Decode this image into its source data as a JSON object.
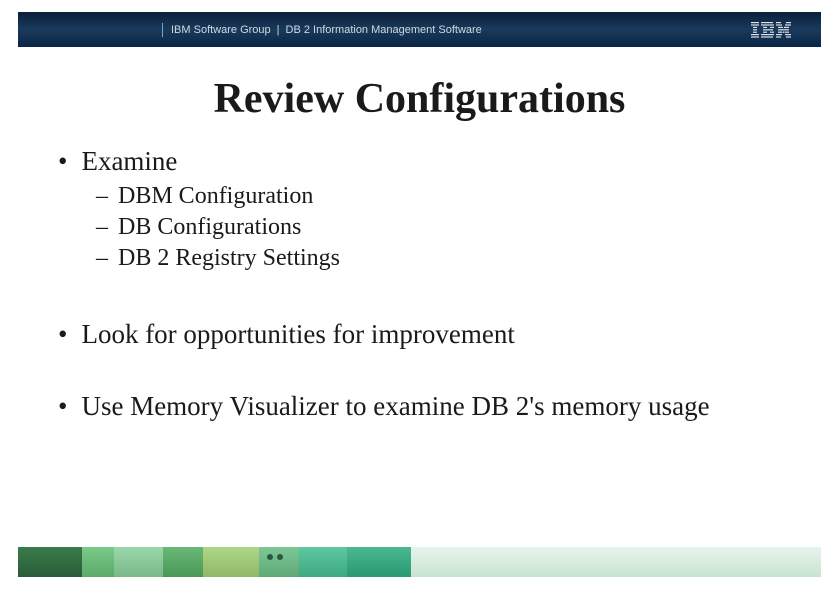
{
  "header": {
    "group_text": "IBM Software Group",
    "separator": "|",
    "product_text": "DB 2 Information Management Software",
    "logo_label": "IBM"
  },
  "slide": {
    "title": "Review Configurations"
  },
  "bullets": [
    {
      "text": "Examine",
      "sub": [
        "DBM Configuration",
        "DB Configurations",
        "DB 2 Registry Settings"
      ]
    },
    {
      "text": "Look for opportunities for improvement",
      "sub": []
    },
    {
      "text": "Use Memory Visualizer to examine DB 2's memory usage",
      "sub": []
    }
  ]
}
